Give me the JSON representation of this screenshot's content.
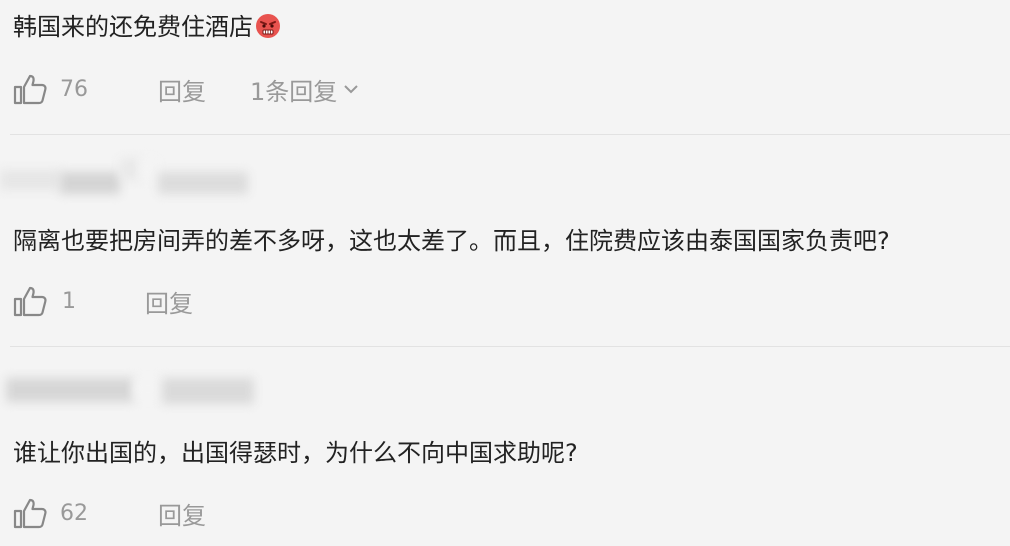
{
  "comments": [
    {
      "text": "韩国来的还免费住酒店",
      "emoji": "angry-face-emoji",
      "like_count": "76",
      "reply_label": "回复",
      "replies_label": "1条回复"
    },
    {
      "text": "隔离也要把房间弄的差不多呀，这也太差了。而且，住院费应该由泰国国家负责吧?",
      "like_count": "1",
      "reply_label": "回复"
    },
    {
      "text": "谁让你出国的，出国得瑟时，为什么不向中国求助呢?",
      "like_count": "62",
      "reply_label": "回复"
    }
  ],
  "icons": {
    "like": "thumbs-up-icon",
    "expand": "chevron-down-icon"
  },
  "colors": {
    "background": "#f4f4f4",
    "text": "#222222",
    "muted": "#999999",
    "divider": "#e2e2e2"
  }
}
